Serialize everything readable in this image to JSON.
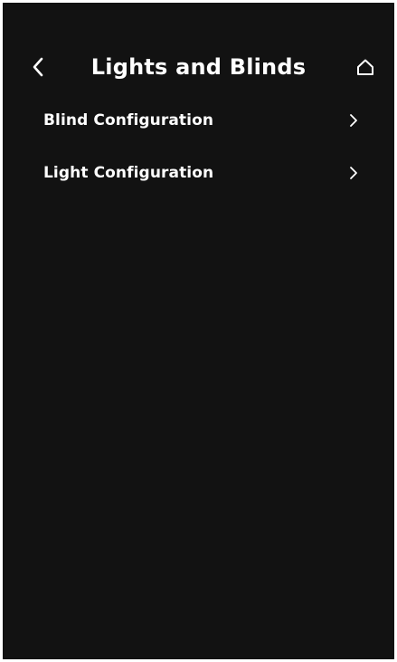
{
  "header": {
    "title": "Lights and Blinds",
    "back_icon": "chevron-left-icon",
    "home_icon": "home-icon"
  },
  "menu": {
    "items": [
      {
        "label": "Blind Configuration",
        "icon": "chevron-right-icon"
      },
      {
        "label": "Light Configuration",
        "icon": "chevron-right-icon"
      }
    ]
  },
  "colors": {
    "background": "#121212",
    "text": "#ffffff",
    "frame": "#ffffff"
  }
}
